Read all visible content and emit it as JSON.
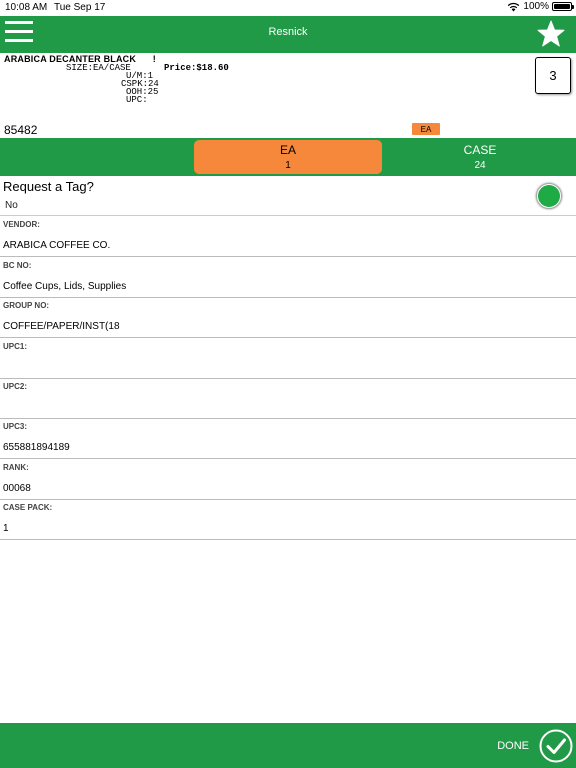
{
  "status_bar": {
    "time": "10:08 AM",
    "date": "Tue Sep 17",
    "battery": "100%"
  },
  "nav": {
    "title": "Resnick"
  },
  "item": {
    "name": "ARABICA DECANTER BLACK",
    "flag": "!",
    "size": "SIZE:EA/CASE",
    "price": "Price:$18.60",
    "um": "U/M:1",
    "cspk": "CSPK:24",
    "ooh": "OOH:25",
    "upc": "UPC:",
    "quantity": "3",
    "number": "85482",
    "unit_tag": "EA"
  },
  "uom": {
    "options": [
      {
        "label": "EA",
        "count": "1"
      },
      {
        "label": "CASE",
        "count": "24"
      }
    ]
  },
  "request_tag": {
    "title": "Request a Tag?",
    "value": "No"
  },
  "fields": [
    {
      "label": "VENDOR:",
      "value": "ARABICA COFFEE CO."
    },
    {
      "label": "BC NO:",
      "value": "Coffee Cups, Lids, Supplies"
    },
    {
      "label": "GROUP NO:",
      "value": "COFFEE/PAPER/INST(18"
    },
    {
      "label": "UPC1:",
      "value": ""
    },
    {
      "label": "UPC2:",
      "value": ""
    },
    {
      "label": "UPC3:",
      "value": "655881894189"
    },
    {
      "label": "RANK:",
      "value": "00068"
    },
    {
      "label": "CASE PACK:",
      "value": "1"
    }
  ],
  "footer": {
    "done_label": "DONE"
  },
  "colors": {
    "brand_green": "#219a47",
    "accent_orange": "#f5883a",
    "toggle_green": "#1eab45"
  }
}
